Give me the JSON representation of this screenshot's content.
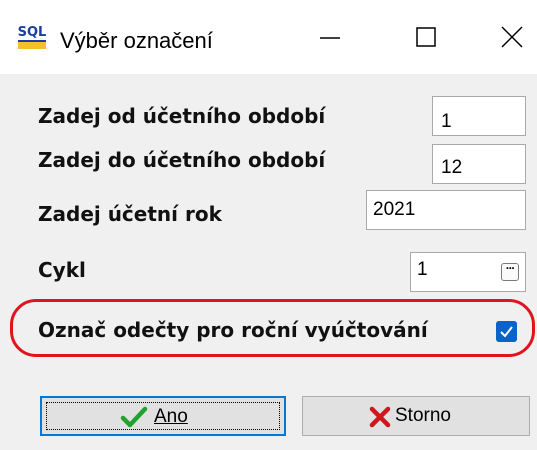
{
  "window": {
    "title": "Výběr označení",
    "app_icon": "sql-app-icon",
    "controls": {
      "minimize": "minimize-icon",
      "maximize": "maximize-icon",
      "close": "close-icon"
    }
  },
  "form": {
    "from_period": {
      "label": "Zadej od účetního období",
      "value": "1"
    },
    "to_period": {
      "label": "Zadej do účetního období",
      "value": "12"
    },
    "year": {
      "label": "Zadej účetní rok",
      "value": "2021"
    },
    "cycle": {
      "label": "Cykl",
      "value": "1",
      "browse_icon": "ellipsis-icon"
    },
    "mark_readings": {
      "label": "Označ odečty pro roční vyúčtování",
      "checked": true
    }
  },
  "buttons": {
    "ok": {
      "label": "Ano",
      "icon": "checkmark-icon"
    },
    "cancel": {
      "label": "Storno",
      "icon": "cross-icon"
    }
  },
  "colors": {
    "highlight": "#e0141e",
    "checkbox": "#0a63c9",
    "focus_border": "#0078d7",
    "check_green": "#1fa22e",
    "cross_red": "#d0161b"
  }
}
